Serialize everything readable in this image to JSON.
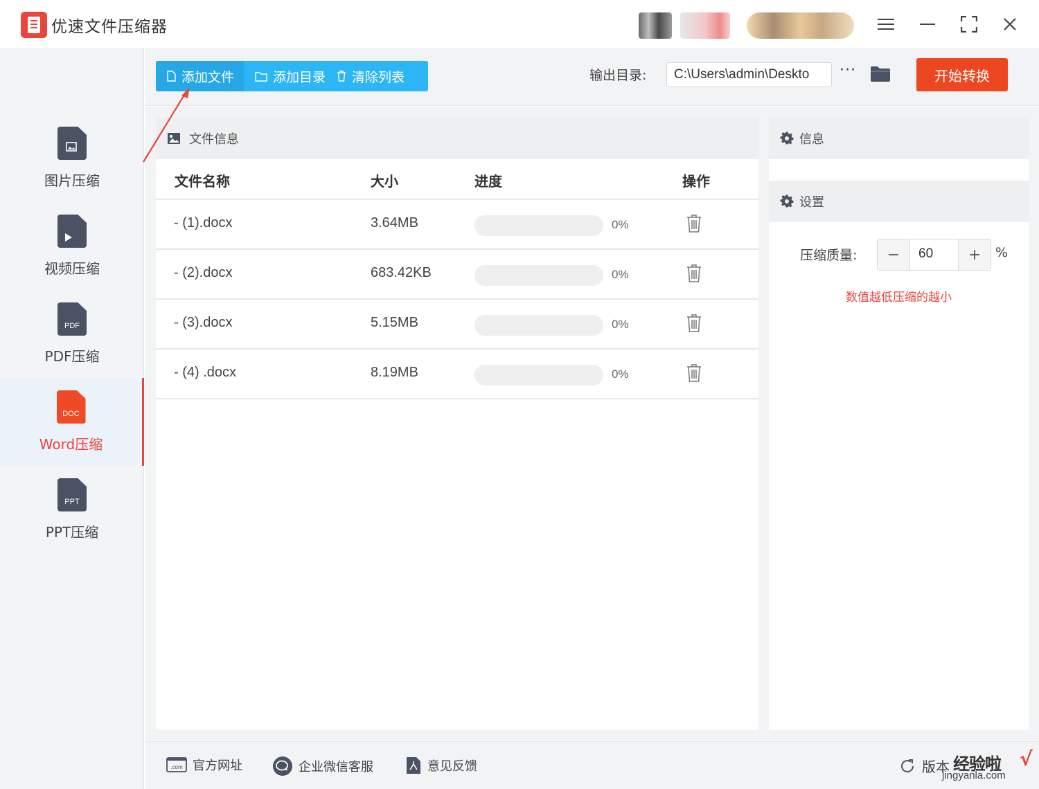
{
  "app": {
    "title": "优速文件压缩器"
  },
  "window_controls": {
    "menu": "≡",
    "minimize": "—",
    "maximize": "⛶",
    "close": "✕"
  },
  "sidebar": {
    "items": [
      {
        "label": "图片压缩",
        "tag": "",
        "icon": "image-file-icon",
        "active": false
      },
      {
        "label": "视频压缩",
        "tag": "",
        "icon": "video-file-icon",
        "active": false
      },
      {
        "label": "PDF压缩",
        "tag": "PDF",
        "icon": "pdf-file-icon",
        "active": false
      },
      {
        "label": "Word压缩",
        "tag": "DOC",
        "icon": "doc-file-icon",
        "active": true
      },
      {
        "label": "PPT压缩",
        "tag": "PPT",
        "icon": "ppt-file-icon",
        "active": false
      }
    ]
  },
  "toolbar": {
    "add_file": "添加文件",
    "add_folder": "添加目录",
    "clear_list": "清除列表",
    "output_label": "输出目录:",
    "output_path": "C:\\Users\\admin\\Deskto",
    "more": "···",
    "start": "开始转换"
  },
  "file_panel": {
    "title": "文件信息",
    "columns": {
      "name": "文件名称",
      "size": "大小",
      "progress": "进度",
      "action": "操作"
    },
    "rows": [
      {
        "name": "- (1).docx",
        "size": "3.64MB",
        "progress": 0,
        "percent": "0%"
      },
      {
        "name": "- (2).docx",
        "size": "683.42KB",
        "progress": 0,
        "percent": "0%"
      },
      {
        "name": "- (3).docx",
        "size": "5.15MB",
        "progress": 0,
        "percent": "0%"
      },
      {
        "name": "- (4) .docx",
        "size": "8.19MB",
        "progress": 0,
        "percent": "0%"
      }
    ]
  },
  "info_panel": {
    "title": "信息"
  },
  "settings_panel": {
    "title": "设置",
    "quality_label": "压缩质量:",
    "minus": "−",
    "quality_value": "60",
    "plus": "+",
    "unit": "%",
    "hint": "数值越低压缩的越小"
  },
  "footer": {
    "website": "官方网址",
    "wechat": "企业微信客服",
    "feedback": "意见反馈",
    "version": "版本"
  },
  "watermark": {
    "brand": "经验啦",
    "domain": "jingyanla.com",
    "check": "√"
  },
  "colors": {
    "accent_red": "#e8453c",
    "toolbar_blue": "#2db6f5",
    "start_orange": "#ec4721"
  }
}
